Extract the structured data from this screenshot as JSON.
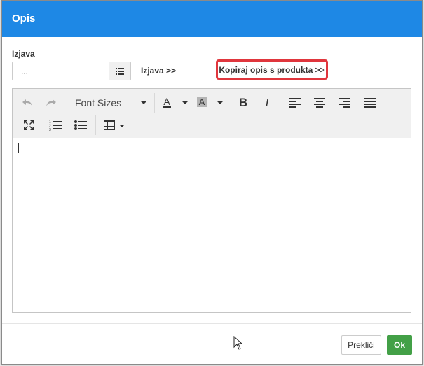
{
  "dialog": {
    "title": "Opis"
  },
  "form": {
    "statement_label": "Izjava",
    "statement_placeholder": "...",
    "statement_link": "Izjava >>",
    "copy_link": "Kopiraj opis s produkta >>"
  },
  "editor": {
    "font_sizes_label": "Font Sizes",
    "font_color_glyph": "A",
    "bg_color_glyph": "A",
    "bold_glyph": "B",
    "italic_glyph": "I",
    "icons": [
      "undo-icon",
      "redo-icon",
      "font-color-icon",
      "background-color-icon",
      "bold-icon",
      "italic-icon",
      "align-left-icon",
      "align-center-icon",
      "align-right-icon",
      "justify-icon",
      "fullscreen-icon",
      "ordered-list-icon",
      "unordered-list-icon",
      "table-icon"
    ]
  },
  "footer": {
    "cancel_label": "Prekliči",
    "ok_label": "Ok"
  },
  "colors": {
    "header": "#1e88e5",
    "ok_button": "#43a047",
    "highlight_border": "#e0363d"
  }
}
